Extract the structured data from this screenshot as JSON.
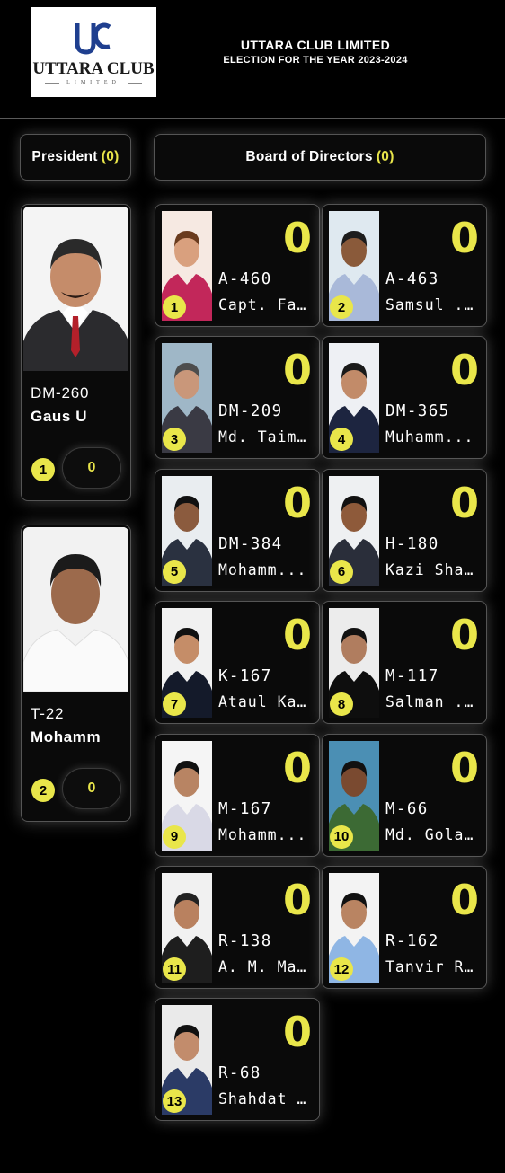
{
  "header": {
    "logo_text": "UTTARA CLUB",
    "logo_sub": "LIMITED",
    "title": "UTTARA CLUB LIMITED",
    "subtitle": "ELECTION FOR THE YEAR 2023-2024"
  },
  "president_section": {
    "label": "President",
    "count_display": "(0)"
  },
  "directors_section": {
    "label": "Board of Directors",
    "count_display": "(0)"
  },
  "colors": {
    "accent": "#e9e64a",
    "background": "#000000",
    "card_border": "#555555"
  },
  "president_candidates": [
    {
      "code": "DM-260",
      "name": "Gaus U",
      "ballot": "1",
      "votes": "0"
    },
    {
      "code": "T-22",
      "name": "Mohamm",
      "ballot": "2",
      "votes": "0"
    }
  ],
  "director_candidates": [
    {
      "code": "A-460",
      "name": "Capt. Fa...",
      "ballot": "1",
      "votes": "0"
    },
    {
      "code": "A-463",
      "name": "Samsul ...",
      "ballot": "2",
      "votes": "0"
    },
    {
      "code": "DM-209",
      "name": "Md. Taim...",
      "ballot": "3",
      "votes": "0"
    },
    {
      "code": "DM-365",
      "name": "Muhamm...",
      "ballot": "4",
      "votes": "0"
    },
    {
      "code": "DM-384",
      "name": "Mohamm...",
      "ballot": "5",
      "votes": "0"
    },
    {
      "code": "H-180",
      "name": "Kazi Sha...",
      "ballot": "6",
      "votes": "0"
    },
    {
      "code": "K-167",
      "name": "Ataul Ka...",
      "ballot": "7",
      "votes": "0"
    },
    {
      "code": "M-117",
      "name": "Salman ...",
      "ballot": "8",
      "votes": "0"
    },
    {
      "code": "M-167",
      "name": "Mohamm...",
      "ballot": "9",
      "votes": "0"
    },
    {
      "code": "M-66",
      "name": "Md. Gola...",
      "ballot": "10",
      "votes": "0"
    },
    {
      "code": "R-138",
      "name": "A. M. Ma...",
      "ballot": "11",
      "votes": "0"
    },
    {
      "code": "R-162",
      "name": "Tanvir R...",
      "ballot": "12",
      "votes": "0"
    },
    {
      "code": "R-68",
      "name": "Shahdat ...",
      "ballot": "13",
      "votes": "0"
    }
  ]
}
